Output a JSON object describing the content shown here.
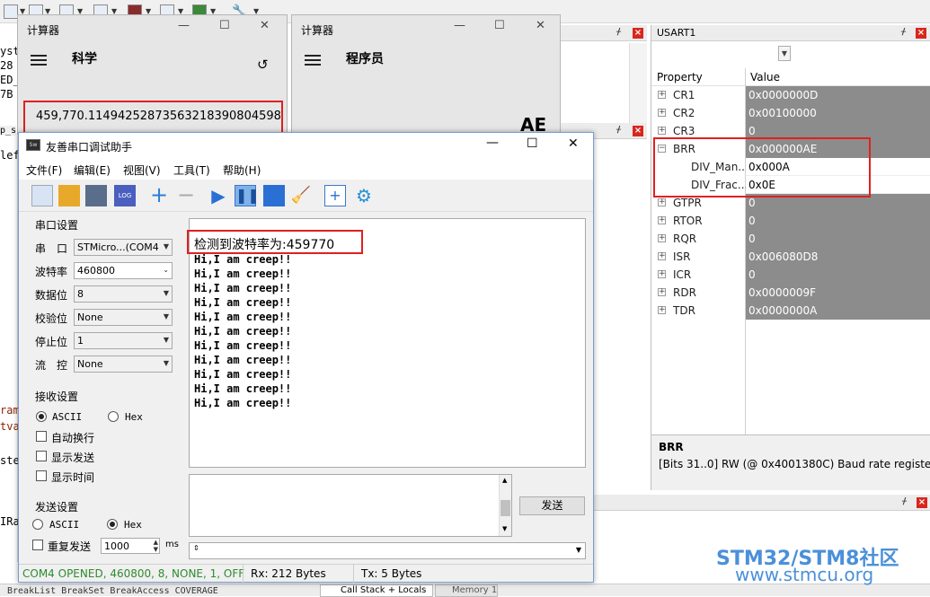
{
  "calc_sci": {
    "title": "计算器",
    "mode": "科学",
    "display": "459,770.1149425287356321839080459​8"
  },
  "calc_prog": {
    "title": "计算器",
    "mode": "程序员",
    "hex_peek": "AE"
  },
  "serial": {
    "title": "友善串口调试助手",
    "menu": [
      "文件(F)",
      "编辑(E)",
      "视图(V)",
      "工具(T)",
      "帮助(H)"
    ],
    "port_group": "串口设置",
    "port_label": "串　口",
    "port_value": "STMicro...(COM4",
    "baud_label": "波特率",
    "baud_value": "460800",
    "data_label": "数据位",
    "data_value": "8",
    "parity_label": "校验位",
    "parity_value": "None",
    "stop_label": "停止位",
    "stop_value": "1",
    "flow_label": "流　控",
    "flow_value": "None",
    "recv_group": "接收设置",
    "recv_ascii": "ASCII",
    "recv_hex": "Hex",
    "auto_wrap": "自动换行",
    "show_send": "显示发送",
    "show_time": "显示时间",
    "send_group": "发送设置",
    "send_ascii": "ASCII",
    "send_hex": "Hex",
    "repeat_send": "重复发送",
    "repeat_ms_value": "1000",
    "ms_unit": "ms",
    "send_button": "发送",
    "recv_lines": [
      "检测到波特率为:459770",
      "Hi,I am creep!!",
      "Hi,I am creep!!",
      "Hi,I am creep!!",
      "Hi,I am creep!!",
      "Hi,I am creep!!",
      "Hi,I am creep!!",
      "Hi,I am creep!!",
      "Hi,I am creep!!",
      "Hi,I am creep!!",
      "Hi,I am creep!!",
      "Hi,I am creep!!",
      "Hi,I am creep!!"
    ],
    "status_port": "COM4 OPENED, 460800, 8, NONE, 1, OFF",
    "status_rx": "Rx: 212 Bytes",
    "status_tx": "Tx: 5 Bytes"
  },
  "usart": {
    "title": "USART1",
    "col_property": "Property",
    "col_value": "Value",
    "rows": [
      {
        "name": "CR1",
        "value": "0x0000000D"
      },
      {
        "name": "CR2",
        "value": "0x00100000"
      },
      {
        "name": "CR3",
        "value": "0"
      },
      {
        "name": "BRR",
        "value": "0x000000AE"
      },
      {
        "name": "DIV_Man...",
        "value": "0x000A"
      },
      {
        "name": "DIV_Frac...",
        "value": "0x0E"
      },
      {
        "name": "GTPR",
        "value": "0"
      },
      {
        "name": "RTOR",
        "value": "0"
      },
      {
        "name": "RQR",
        "value": "0"
      },
      {
        "name": "ISR",
        "value": "0x006080D8"
      },
      {
        "name": "ICR",
        "value": "0"
      },
      {
        "name": "RDR",
        "value": "0x0000009F"
      },
      {
        "name": "TDR",
        "value": "0x0000000A"
      }
    ],
    "desc_title": "BRR",
    "desc_text": "[Bits 31..0] RW (@ 0x4001380C) Baud rate register"
  },
  "ide": {
    "code_fragments": [
      "yst",
      "28",
      "ED_",
      "7B",
      "p_s",
      "lef",
      "ram",
      "tva",
      "ste",
      "IRa"
    ],
    "bottom_tabs": [
      "BreakList BreakSet BreakAccess COVERAGE",
      "Call Stack + Locals",
      "Memory 1"
    ]
  },
  "watermark": {
    "line1": "STM32/STM8社区",
    "line2": "www.stmcu.org"
  },
  "colors": {
    "highlight": "#e02020",
    "status_green": "#2e8b2e",
    "value_cell": "#8c8c8c",
    "watermark": "#4a90d9"
  }
}
